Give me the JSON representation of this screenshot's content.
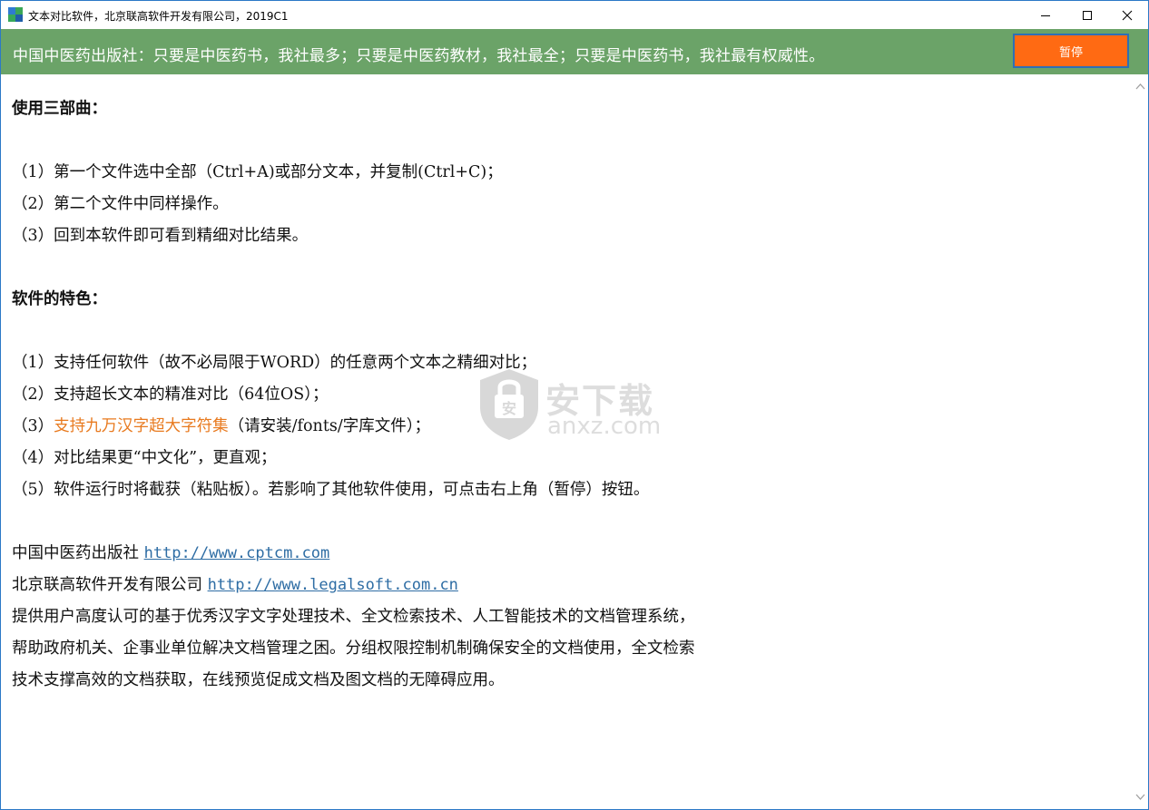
{
  "window": {
    "title": "文本对比软件，北京联高软件开发有限公司，2019C1",
    "app_icon": "app-grid-icon",
    "controls": {
      "minimize": "minimize-icon",
      "maximize": "maximize-icon",
      "close": "close-icon"
    }
  },
  "banner": {
    "text": "中国中医药出版社：只要是中医药书，我社最多；只要是中医药教材，我社最全；只要是中医药书，我社最有权威性。",
    "pause_label": "暂停",
    "colors": {
      "background": "#6ba368",
      "button": "#ff6a13",
      "button_border": "#2f6fb5"
    }
  },
  "content": {
    "usage_heading": "使用三部曲：",
    "usage_steps": [
      "（1）第一个文件选中全部（Ctrl+A)或部分文本，并复制(Ctrl+C)；",
      "（2）第二个文件中同样操作。",
      "（3）回到本软件即可看到精细对比结果。"
    ],
    "features_heading": "软件的特色：",
    "features": [
      "（1）支持任何软件（故不必局限于WORD）的任意两个文本之精细对比；",
      "（2）支持超长文本的精准对比（64位OS）；",
      {
        "prefix": "（3）",
        "highlight": "支持九万汉字超大字符集",
        "suffix": "（请安装/fonts/字库文件）；"
      },
      "（4）对比结果更“中文化”，更直观；",
      "（5）软件运行时将截获（粘贴板）。若影响了其他软件使用，可点击右上角（暂停）按钮。"
    ],
    "highlight_color": "#e87a1f",
    "publisher": {
      "name": "中国中医药出版社",
      "url": "http://www.cptcm.com"
    },
    "company": {
      "name": "北京联高软件开发有限公司",
      "url": "http://www.legalsoft.com.cn"
    },
    "description": [
      "提供用户高度认可的基于优秀汉字文字处理技术、全文检索技术、人工智能技术的文档管理系统，",
      "帮助政府机关、企事业单位解决文档管理之困。分组权限控制机制确保安全的文档使用，全文检索",
      "技术支撑高效的文档获取，在线预览促成文档及图文档的无障碍应用。"
    ],
    "link_color": "#2e6da4"
  },
  "watermark": {
    "cn": "安下载",
    "en": "anxz.com",
    "icon": "shield-icon"
  },
  "scrollbar": {
    "up": "scroll-up-icon",
    "down": "scroll-down-icon"
  }
}
